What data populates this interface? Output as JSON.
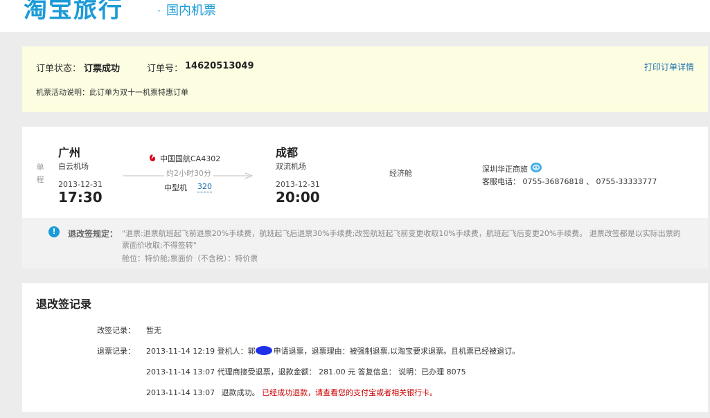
{
  "header": {
    "logo": "淘宝旅行",
    "dot": "·",
    "section": "国内机票"
  },
  "status": {
    "status_label": "订单状态：",
    "status_value": "订票成功",
    "order_label": "订单号：",
    "order_value": "14620513049",
    "print_link": "打印订单详情",
    "activity_note": "机票活动说明：此订单为双十一机票特惠订单"
  },
  "flight": {
    "trip_type": "单程",
    "departure": {
      "city": "广州",
      "airport": "白云机场",
      "date": "2013-12-31",
      "time": "17:30"
    },
    "arrival": {
      "city": "成都",
      "airport": "双流机场",
      "date": "2013-12-31",
      "time": "20:00"
    },
    "airline": "中国国航CA4302",
    "duration": "约2小时30分",
    "plane_type": "中型机",
    "plane_code": "320",
    "cabin": "经济舱",
    "agency": "深圳华正商旅",
    "service_phone": "客服电话：  0755-36876818  、 0755-33333777",
    "colors": {
      "brand": "#1a9bd7",
      "airline_logo": "#d6001c"
    }
  },
  "rules": {
    "label": "退改签规定：",
    "text": "\"退票:退票航班起飞前退票20%手续费，航班起飞后退票30%手续费;改签航班起飞前变更收取10%手续费，航班起飞后变更20%手续费。 退票改签都是以实际出票的票面价收取;不得签转\"",
    "cabin_note": "舱位：特价舱;票面价（不含税）：特价票"
  },
  "records": {
    "title": "退改签记录",
    "change_label": "改签记录：",
    "change_value": "暂无",
    "refund_label": "退票记录：",
    "lines": [
      {
        "time": "2013-11-14 12:19",
        "prefix": "登机人：郭",
        "text": "申请退票，退票理由：被强制退票,以淘宝要求退票。且机票已经被退订。"
      },
      {
        "time": "2013-11-14 13:07",
        "text": "代理商接受退票，退款金额：  281.00 元    答复信息：  说明：已办理 8075"
      },
      {
        "time": "2013-11-14 13:07",
        "text": "退款成功。",
        "highlight": "已经成功退款，请查看您的支付宝或者相关银行卡。"
      }
    ],
    "colors": {
      "highlight": "#cc0000"
    }
  }
}
